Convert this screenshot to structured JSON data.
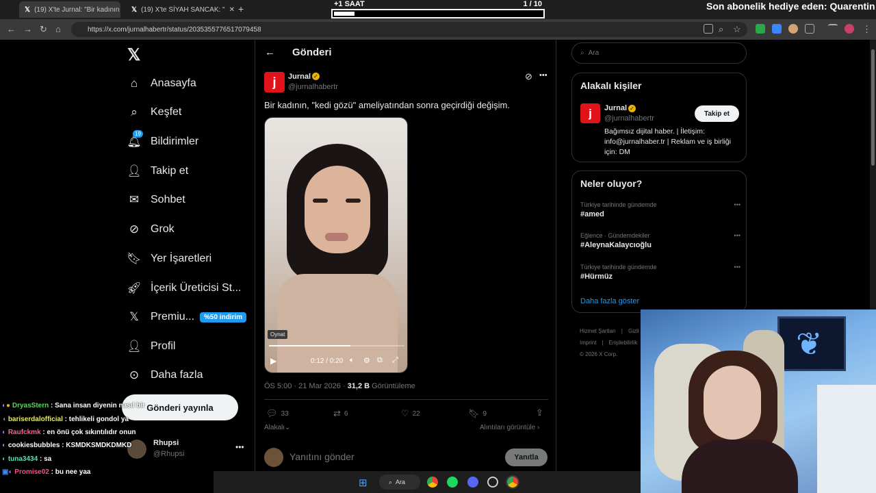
{
  "browser": {
    "tabs": [
      {
        "label": "(19) X'te Jurnal: \"Bir kadının"
      },
      {
        "label": "(19) X'te SİYAH SANCAK: \""
      }
    ],
    "url": "https://x.com/jurnalhabertr/status/2035355776517079458"
  },
  "overlay": {
    "timer_label": "+1 SAAT",
    "timer_count": "1 / 10",
    "timer_progress": 0.1,
    "subscription_text": "Son abonelik hediye eden: Quarentin"
  },
  "nav": {
    "items": [
      {
        "label": "Anasayfa",
        "icon": "home-icon"
      },
      {
        "label": "Keşfet",
        "icon": "search-icon"
      },
      {
        "label": "Bildirimler",
        "icon": "bell-icon",
        "badge": "19"
      },
      {
        "label": "Takip et",
        "icon": "follow-icon"
      },
      {
        "label": "Sohbet",
        "icon": "mail-icon"
      },
      {
        "label": "Grok",
        "icon": "grok-icon"
      },
      {
        "label": "Yer İşaretleri",
        "icon": "bookmark-icon"
      },
      {
        "label": "İçerik Üreticisi St...",
        "icon": "rocket-icon"
      },
      {
        "label": "Premiu...",
        "icon": "x-icon",
        "badge": "%50 indirim"
      },
      {
        "label": "Profil",
        "icon": "person-icon"
      },
      {
        "label": "Daha fazla",
        "icon": "more-icon"
      }
    ],
    "post_button": "Gönderi yayınla",
    "account": {
      "name": "Rhupsi",
      "handle": "@Rhupsi"
    }
  },
  "post": {
    "header": "Gönderi",
    "author_name": "Jurnal",
    "author_handle": "@jurnalhabertr",
    "text": "Bir kadının, \"kedi gözü\" ameliyatından sonra geçirdiği değişim.",
    "video": {
      "tooltip": "Oynat",
      "time": "0:12 / 0:20",
      "progress": 0.6
    },
    "meta_time": "ÖS 5:00 · 21 Mar 2026 · ",
    "views_count": "31,2 B",
    "views_label": " Görüntüleme",
    "stats": {
      "replies": "33",
      "reposts": "6",
      "likes": "22",
      "bookmarks": "9"
    },
    "related_label": "Alakalı",
    "quotes_label": "Alıntıları görüntüle",
    "reply_placeholder": "Yanıtını gönder",
    "reply_button": "Yanıtla"
  },
  "sidebar": {
    "search_placeholder": "Ara",
    "relevant_title": "Alakalı kişiler",
    "relevant_person": {
      "name": "Jurnal",
      "handle": "@jurnalhabertr",
      "follow": "Takip et",
      "bio": "Bağımsız dijital haber. | İletişim: info@jurnalhaber.tr | Reklam ve iş birliği için: DM"
    },
    "trends_title": "Neler oluyor?",
    "trends": [
      {
        "category": "Türkiye tarihinde gündemde",
        "name": "#amed"
      },
      {
        "category": "Eğlence · Gündemdekiler",
        "name": "#AleynaKalaycıoğlu"
      },
      {
        "category": "Türkiye tarihinde gündemde",
        "name": "#Hürmüz"
      }
    ],
    "show_more": "Daha fazla göster",
    "footer": [
      "Hizmet Şartları",
      "Gizli",
      "Imprint",
      "Erişilebilirlik",
      "© 2026 X Corp."
    ]
  },
  "chat": [
    {
      "user": "DryasStern",
      "msg": " : Sana insan diyenin nasıl bir",
      "color": "#5cd65c"
    },
    {
      "user": "bariserdalofficial",
      "msg": " : tehlikeli gondol ya",
      "color": "#e8e86a"
    },
    {
      "user": "Raufckmk",
      "msg": " : en önü çok sıkıntılıdır onun",
      "color": "#ff5e9a"
    },
    {
      "user": "cookiesbubbles",
      "msg": " : KSMDKSMDKDMKD",
      "color": "#ffffff"
    },
    {
      "user": "tuna3434",
      "msg": " : sa",
      "color": "#62e0b0"
    },
    {
      "user": "Promise02",
      "msg": " : bu nee yaa",
      "color": "#ff4f86"
    }
  ],
  "taskbar": {
    "search": "Ara"
  }
}
